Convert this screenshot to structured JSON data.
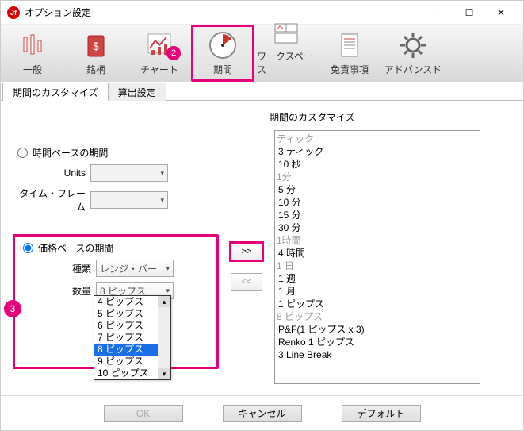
{
  "window": {
    "title": "オプション設定"
  },
  "toolbar": {
    "items": [
      {
        "label": "一般",
        "name": "general"
      },
      {
        "label": "銘柄",
        "name": "symbols"
      },
      {
        "label": "チャート",
        "name": "chart",
        "badge": "2"
      },
      {
        "label": "期間",
        "name": "period",
        "highlight": true
      },
      {
        "label": "ワークスペース",
        "name": "workspace"
      },
      {
        "label": "免責事項",
        "name": "disclaimer"
      },
      {
        "label": "アドバンスド",
        "name": "advanced"
      }
    ]
  },
  "tabs": {
    "customize": "期間のカスタマイズ",
    "calc": "算出設定"
  },
  "fieldset_legend": "期間のカスタマイズ",
  "time_section": {
    "title": "時間ベースの期間",
    "units_label": "Units",
    "timeframe_label": "タイム・フレーム"
  },
  "price_section": {
    "title": "価格ベースの期間",
    "type_label": "種類",
    "type_value": "レンジ・バー",
    "qty_label": "数量",
    "qty_value": "8 ピップス",
    "dropdown": [
      "4 ピップス",
      "5 ピップス",
      "6 ピップス",
      "7 ピップス",
      "8 ピップス",
      "9 ピップス",
      "10 ピップス"
    ],
    "badge": "3"
  },
  "list": {
    "groups": [
      {
        "header": "ティック",
        "items": [
          "3 ティック",
          "10 秒"
        ]
      },
      {
        "header": "1分",
        "items": [
          "5 分",
          "10 分",
          "15 分",
          "30 分"
        ]
      },
      {
        "header": "1時間",
        "items": [
          "4 時間"
        ]
      },
      {
        "header": "1 日",
        "items": [
          "1 週",
          "1 月",
          "1 ピップス"
        ]
      },
      {
        "header": "8 ピップス",
        "items": [
          "P&F(1 ピップス x 3)",
          "Renko 1 ピップス",
          "3 Line Break"
        ]
      }
    ]
  },
  "transfer": {
    "add": ">>",
    "remove": "<<"
  },
  "footer": {
    "ok": "OK",
    "cancel": "キャンセル",
    "default": "デフォルト"
  }
}
